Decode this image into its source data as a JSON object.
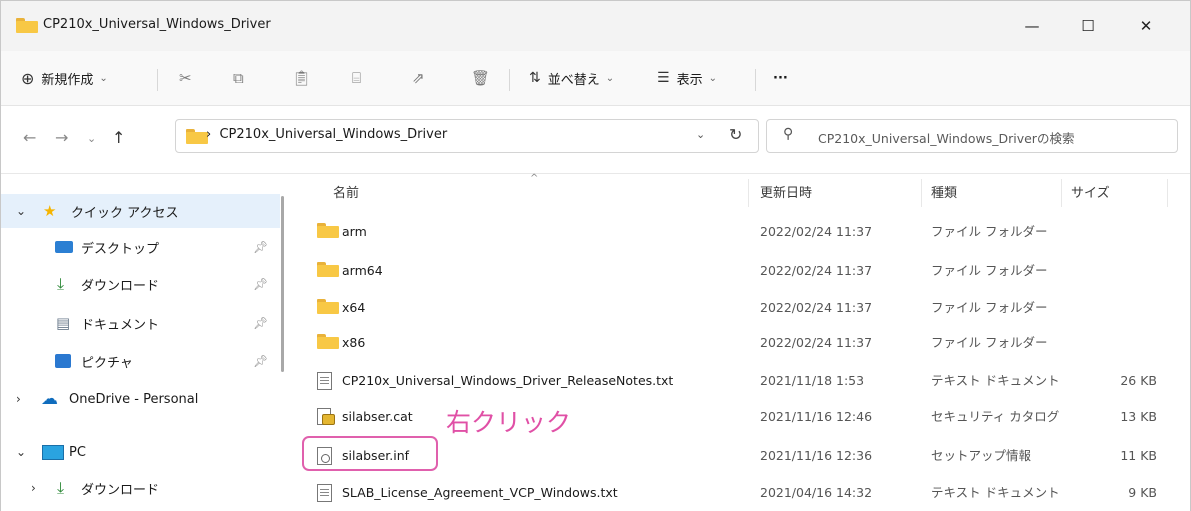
{
  "window": {
    "title": "CP210x_Universal_Windows_Driver",
    "controls": {
      "minimize": "—",
      "maximize": "☐",
      "close": "✕"
    }
  },
  "toolbar": {
    "new_label": "新規作成",
    "sort_label": "並べ替え",
    "view_label": "表示",
    "more_label": "···"
  },
  "address": {
    "breadcrumb": "CP210x_Universal_Windows_Driver",
    "search_placeholder": "CP210x_Universal_Windows_Driverの検索"
  },
  "nav": {
    "quick_access": "クイック アクセス",
    "items": [
      {
        "label": "デスクトップ",
        "icon": "desktop-icon"
      },
      {
        "label": "ダウンロード",
        "icon": "download-icon"
      },
      {
        "label": "ドキュメント",
        "icon": "document-icon"
      },
      {
        "label": "ピクチャ",
        "icon": "pictures-icon"
      }
    ],
    "onedrive": "OneDrive - Personal",
    "pc": "PC",
    "pc_downloads": "ダウンロード"
  },
  "columns": {
    "name": "名前",
    "date": "更新日時",
    "type": "種類",
    "size": "サイズ"
  },
  "files": [
    {
      "name": "arm",
      "date": "2022/02/24 11:37",
      "type": "ファイル フォルダー",
      "size": "",
      "kind": "folder"
    },
    {
      "name": "arm64",
      "date": "2022/02/24 11:37",
      "type": "ファイル フォルダー",
      "size": "",
      "kind": "folder"
    },
    {
      "name": "x64",
      "date": "2022/02/24 11:37",
      "type": "ファイル フォルダー",
      "size": "",
      "kind": "folder"
    },
    {
      "name": "x86",
      "date": "2022/02/24 11:37",
      "type": "ファイル フォルダー",
      "size": "",
      "kind": "folder"
    },
    {
      "name": "CP210x_Universal_Windows_Driver_ReleaseNotes.txt",
      "date": "2021/11/18 1:53",
      "type": "テキスト ドキュメント",
      "size": "26 KB",
      "kind": "txt"
    },
    {
      "name": "silabser.cat",
      "date": "2021/11/16 12:46",
      "type": "セキュリティ カタログ",
      "size": "13 KB",
      "kind": "cat"
    },
    {
      "name": "silabser.inf",
      "date": "2021/11/16 12:36",
      "type": "セットアップ情報",
      "size": "11 KB",
      "kind": "inf"
    },
    {
      "name": "SLAB_License_Agreement_VCP_Windows.txt",
      "date": "2021/04/16 14:32",
      "type": "テキスト ドキュメント",
      "size": "9 KB",
      "kind": "txt"
    }
  ],
  "annotation": {
    "text": "右クリック",
    "color": "#e050a6"
  },
  "colors": {
    "accent": "#0078d4",
    "selection": "#e5f0fb",
    "folder": "#f8c845",
    "highlight": "#e060ad"
  }
}
